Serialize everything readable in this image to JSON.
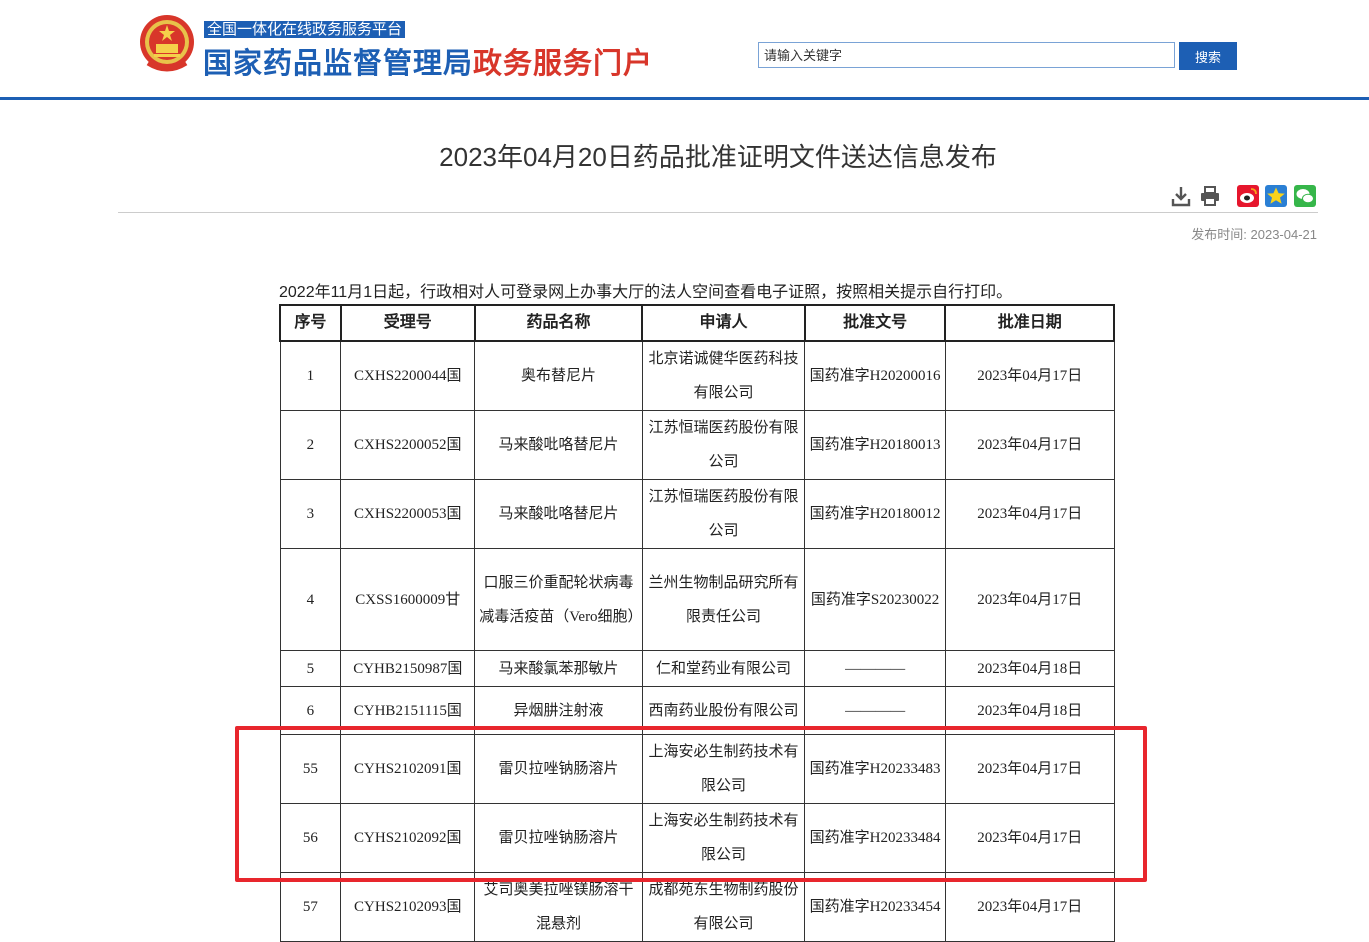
{
  "header": {
    "platform_tag": "全国一体化在线政务服务平台",
    "title_blue": "国家药品监督管理局",
    "title_red": "政务服务门户",
    "search_placeholder": "请输入关键字",
    "search_button": "搜索"
  },
  "article": {
    "title": "2023年04月20日药品批准证明文件送达信息发布",
    "publish_label": "发布时间:",
    "publish_date": "2023-04-21",
    "notice": "2022年11月1日起，行政相对人可登录网上办事大厅的法人空间查看电子证照，按照相关提示自行打印。"
  },
  "tools": {
    "download_icon": "download-icon",
    "print_icon": "print-icon",
    "weibo_icon": "weibo-share-icon",
    "favorite_icon": "favorite-star-icon",
    "wechat_icon": "wechat-share-icon"
  },
  "table": {
    "columns": [
      "序号",
      "受理号",
      "药品名称",
      "申请人",
      "批准文号",
      "批准日期"
    ],
    "rows": [
      {
        "no": "1",
        "accept": "CXHS2200044国",
        "drug": "奥布替尼片",
        "applicant": "北京诺诚健华医药科技有限公司",
        "approval": "国药准字H20200016",
        "date": "2023年04月17日"
      },
      {
        "no": "2",
        "accept": "CXHS2200052国",
        "drug": "马来酸吡咯替尼片",
        "applicant": "江苏恒瑞医药股份有限公司",
        "approval": "国药准字H20180013",
        "date": "2023年04月17日"
      },
      {
        "no": "3",
        "accept": "CXHS2200053国",
        "drug": "马来酸吡咯替尼片",
        "applicant": "江苏恒瑞医药股份有限公司",
        "approval": "国药准字H20180012",
        "date": "2023年04月17日"
      },
      {
        "no": "4",
        "accept": "CXSS1600009甘",
        "drug": "口服三价重配轮状病毒减毒活疫苗（Vero细胞）",
        "applicant": "兰州生物制品研究所有限责任公司",
        "approval": "国药准字S20230022",
        "date": "2023年04月17日"
      },
      {
        "no": "5",
        "accept": "CYHB2150987国",
        "drug": "马来酸氯苯那敏片",
        "applicant": "仁和堂药业有限公司",
        "approval": "————",
        "date": "2023年04月18日"
      },
      {
        "no": "6",
        "accept": "CYHB2151115国",
        "drug": "异烟肼注射液",
        "applicant": "西南药业股份有限公司",
        "approval": "————",
        "date": "2023年04月18日"
      },
      {
        "no": "55",
        "accept": "CYHS2102091国",
        "drug": "雷贝拉唑钠肠溶片",
        "applicant": "上海安必生制药技术有限公司",
        "approval": "国药准字H20233483",
        "date": "2023年04月17日"
      },
      {
        "no": "56",
        "accept": "CYHS2102092国",
        "drug": "雷贝拉唑钠肠溶片",
        "applicant": "上海安必生制药技术有限公司",
        "approval": "国药准字H20233484",
        "date": "2023年04月17日"
      },
      {
        "no": "57",
        "accept": "CYHS2102093国",
        "drug": "艾司奥美拉唑镁肠溶干混悬剂",
        "applicant": "成都苑东生物制药股份有限公司",
        "approval": "国药准字H20233454",
        "date": "2023年04月17日"
      }
    ]
  },
  "colors": {
    "brand_blue": "#1d5fb4",
    "brand_red": "#d8362a",
    "highlight_red": "#e8262d"
  }
}
